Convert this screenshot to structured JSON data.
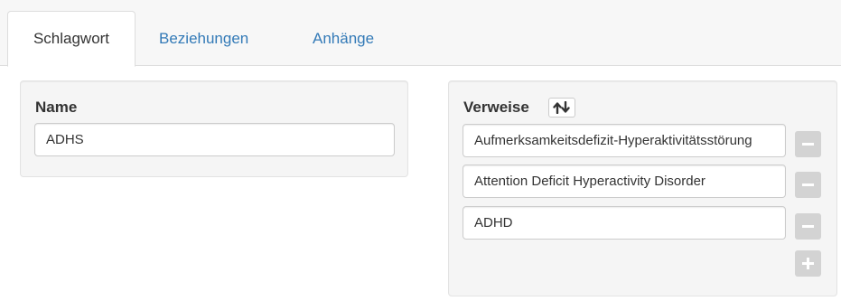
{
  "tabs": [
    {
      "label": "Schlagwort",
      "active": true
    },
    {
      "label": "Beziehungen",
      "active": false
    },
    {
      "label": "Anhänge",
      "active": false
    }
  ],
  "name_panel": {
    "label": "Name",
    "value": "ADHS"
  },
  "verweise_panel": {
    "label": "Verweise",
    "sort_icon": "sort-arrows-icon",
    "entries": [
      {
        "value": "Aufmerksamkeitsdefizit-Hyperaktivitätsstörung",
        "remove_icon": "minus-icon"
      },
      {
        "value": "Attention Deficit Hyperactivity Disorder",
        "remove_icon": "minus-icon"
      },
      {
        "value": "ADHD",
        "remove_icon": "minus-icon"
      }
    ],
    "add_icon": "plus-icon"
  },
  "colors": {
    "link": "#337ab7",
    "panel_bg": "#f5f5f5",
    "button_disabled": "#d3d3d3"
  }
}
